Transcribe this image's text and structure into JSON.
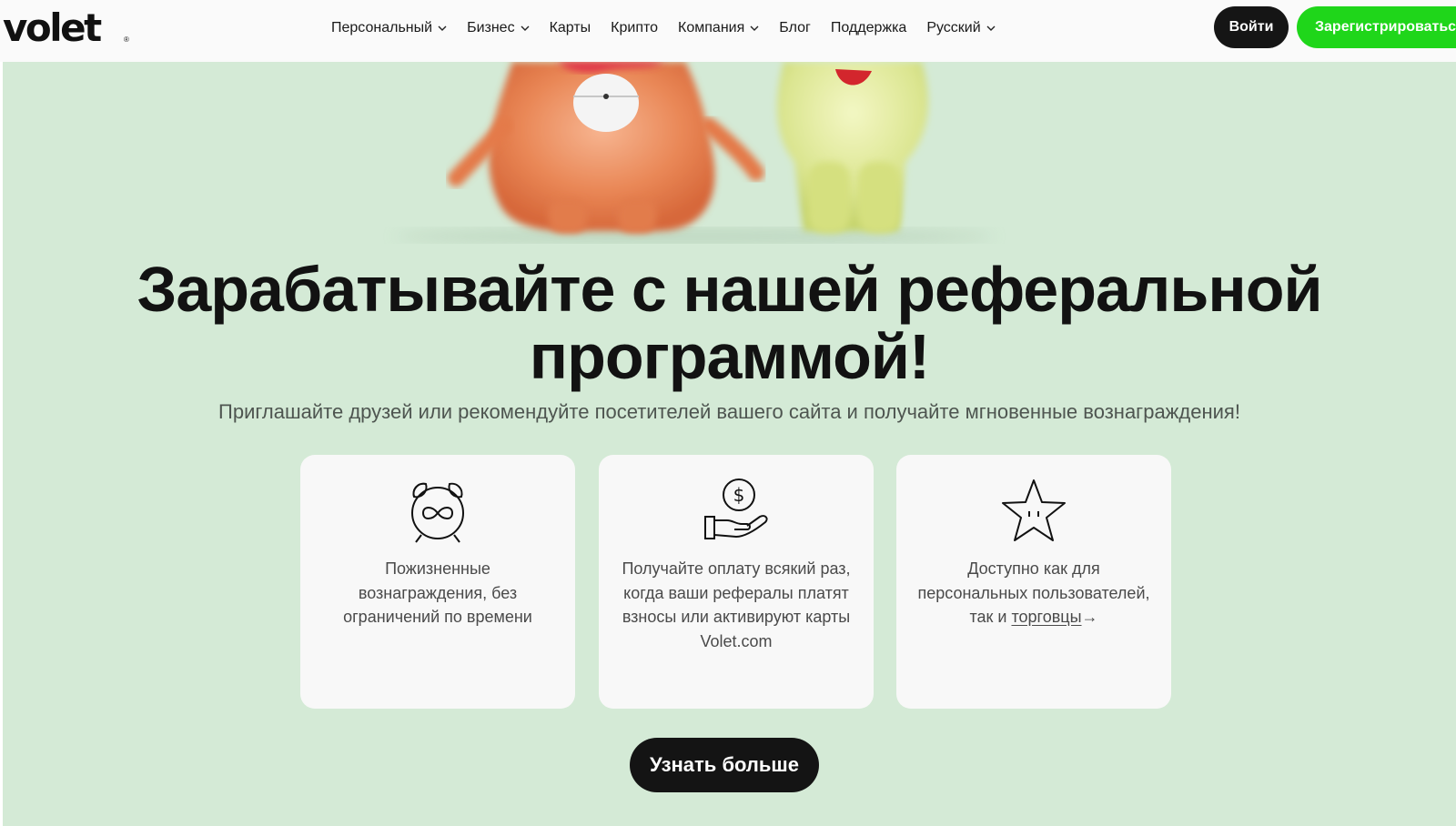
{
  "header": {
    "logo": "volet",
    "logo_mark": "®",
    "nav": [
      {
        "label": "Персональный",
        "dropdown": true
      },
      {
        "label": "Бизнес",
        "dropdown": true
      },
      {
        "label": "Карты",
        "dropdown": false
      },
      {
        "label": "Крипто",
        "dropdown": false
      },
      {
        "label": "Компания",
        "dropdown": true
      },
      {
        "label": "Блог",
        "dropdown": false
      },
      {
        "label": "Поддержка",
        "dropdown": false
      },
      {
        "label": "Русский",
        "dropdown": true
      }
    ],
    "login_label": "Войти",
    "register_label": "Зарегистрироваться"
  },
  "hero": {
    "title": "Зарабатывайте с нашей реферальной программой!",
    "subtitle": "Приглашайте друзей или рекомендуйте посетителей вашего сайта и получайте мгновенные вознаграждения!",
    "cards": [
      {
        "icon": "alarm-clock-infinity-icon",
        "text": "Пожизненные вознаграждения, без ограничений по времени"
      },
      {
        "icon": "hand-coin-icon",
        "text": "Получайте оплату всякий раз, когда ваши рефералы платят взносы или активируют карты Volet.com"
      },
      {
        "icon": "star-icon",
        "text": "Доступно как для персональных пользователей, так и",
        "link": "торговцы",
        "link_arrow": "→"
      }
    ],
    "cta_label": "Узнать больше"
  },
  "colors": {
    "hero_background": "#d4ead6",
    "register_button": "#1fd61a",
    "dark_button": "#141414"
  }
}
